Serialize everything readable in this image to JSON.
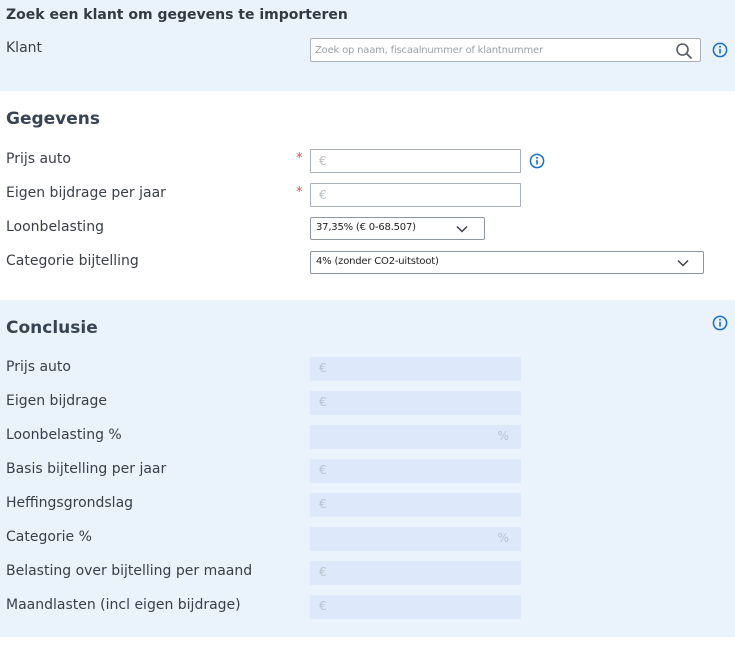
{
  "import": {
    "title": "Zoek een klant om gegevens te importeren",
    "klant_label": "Klant",
    "search_placeholder": "Zoek op naam, fiscaalnummer of klantnummer",
    "search_value": ""
  },
  "gegevens": {
    "title": "Gegevens",
    "prijs_auto": {
      "label": "Prijs auto",
      "required": "*",
      "currency": "€",
      "value": ""
    },
    "eigen_bijdrage": {
      "label": "Eigen bijdrage per jaar",
      "required": "*",
      "currency": "€",
      "value": ""
    },
    "loonbelasting": {
      "label": "Loonbelasting",
      "selected": "37,35% (€ 0-68.507)"
    },
    "categorie": {
      "label": "Categorie bijtelling",
      "selected": "4% (zonder CO2-uitstoot)"
    }
  },
  "conclusie": {
    "title": "Conclusie",
    "rows": [
      {
        "label": "Prijs auto",
        "currency": "€",
        "unit": ""
      },
      {
        "label": "Eigen bijdrage",
        "currency": "€",
        "unit": ""
      },
      {
        "label": "Loonbelasting %",
        "currency": "",
        "unit": "%"
      },
      {
        "label": "Basis bijtelling per jaar",
        "currency": "€",
        "unit": ""
      },
      {
        "label": "Heffingsgrondslag",
        "currency": "€",
        "unit": ""
      },
      {
        "label": "Categorie %",
        "currency": "",
        "unit": "%"
      },
      {
        "label": "Belasting over bijtelling per maand",
        "currency": "€",
        "unit": ""
      },
      {
        "label": "Maandlasten (incl eigen bijdrage)",
        "currency": "€",
        "unit": ""
      }
    ]
  },
  "icons": {
    "info": "info-circle-icon",
    "search": "search-icon",
    "chevron": "chevron-down-icon"
  },
  "colors": {
    "accent": "#1a6fc9",
    "required": "#d9534f",
    "section_bg": "#eaf2fc",
    "readonly_bg": "#dde9fa"
  }
}
